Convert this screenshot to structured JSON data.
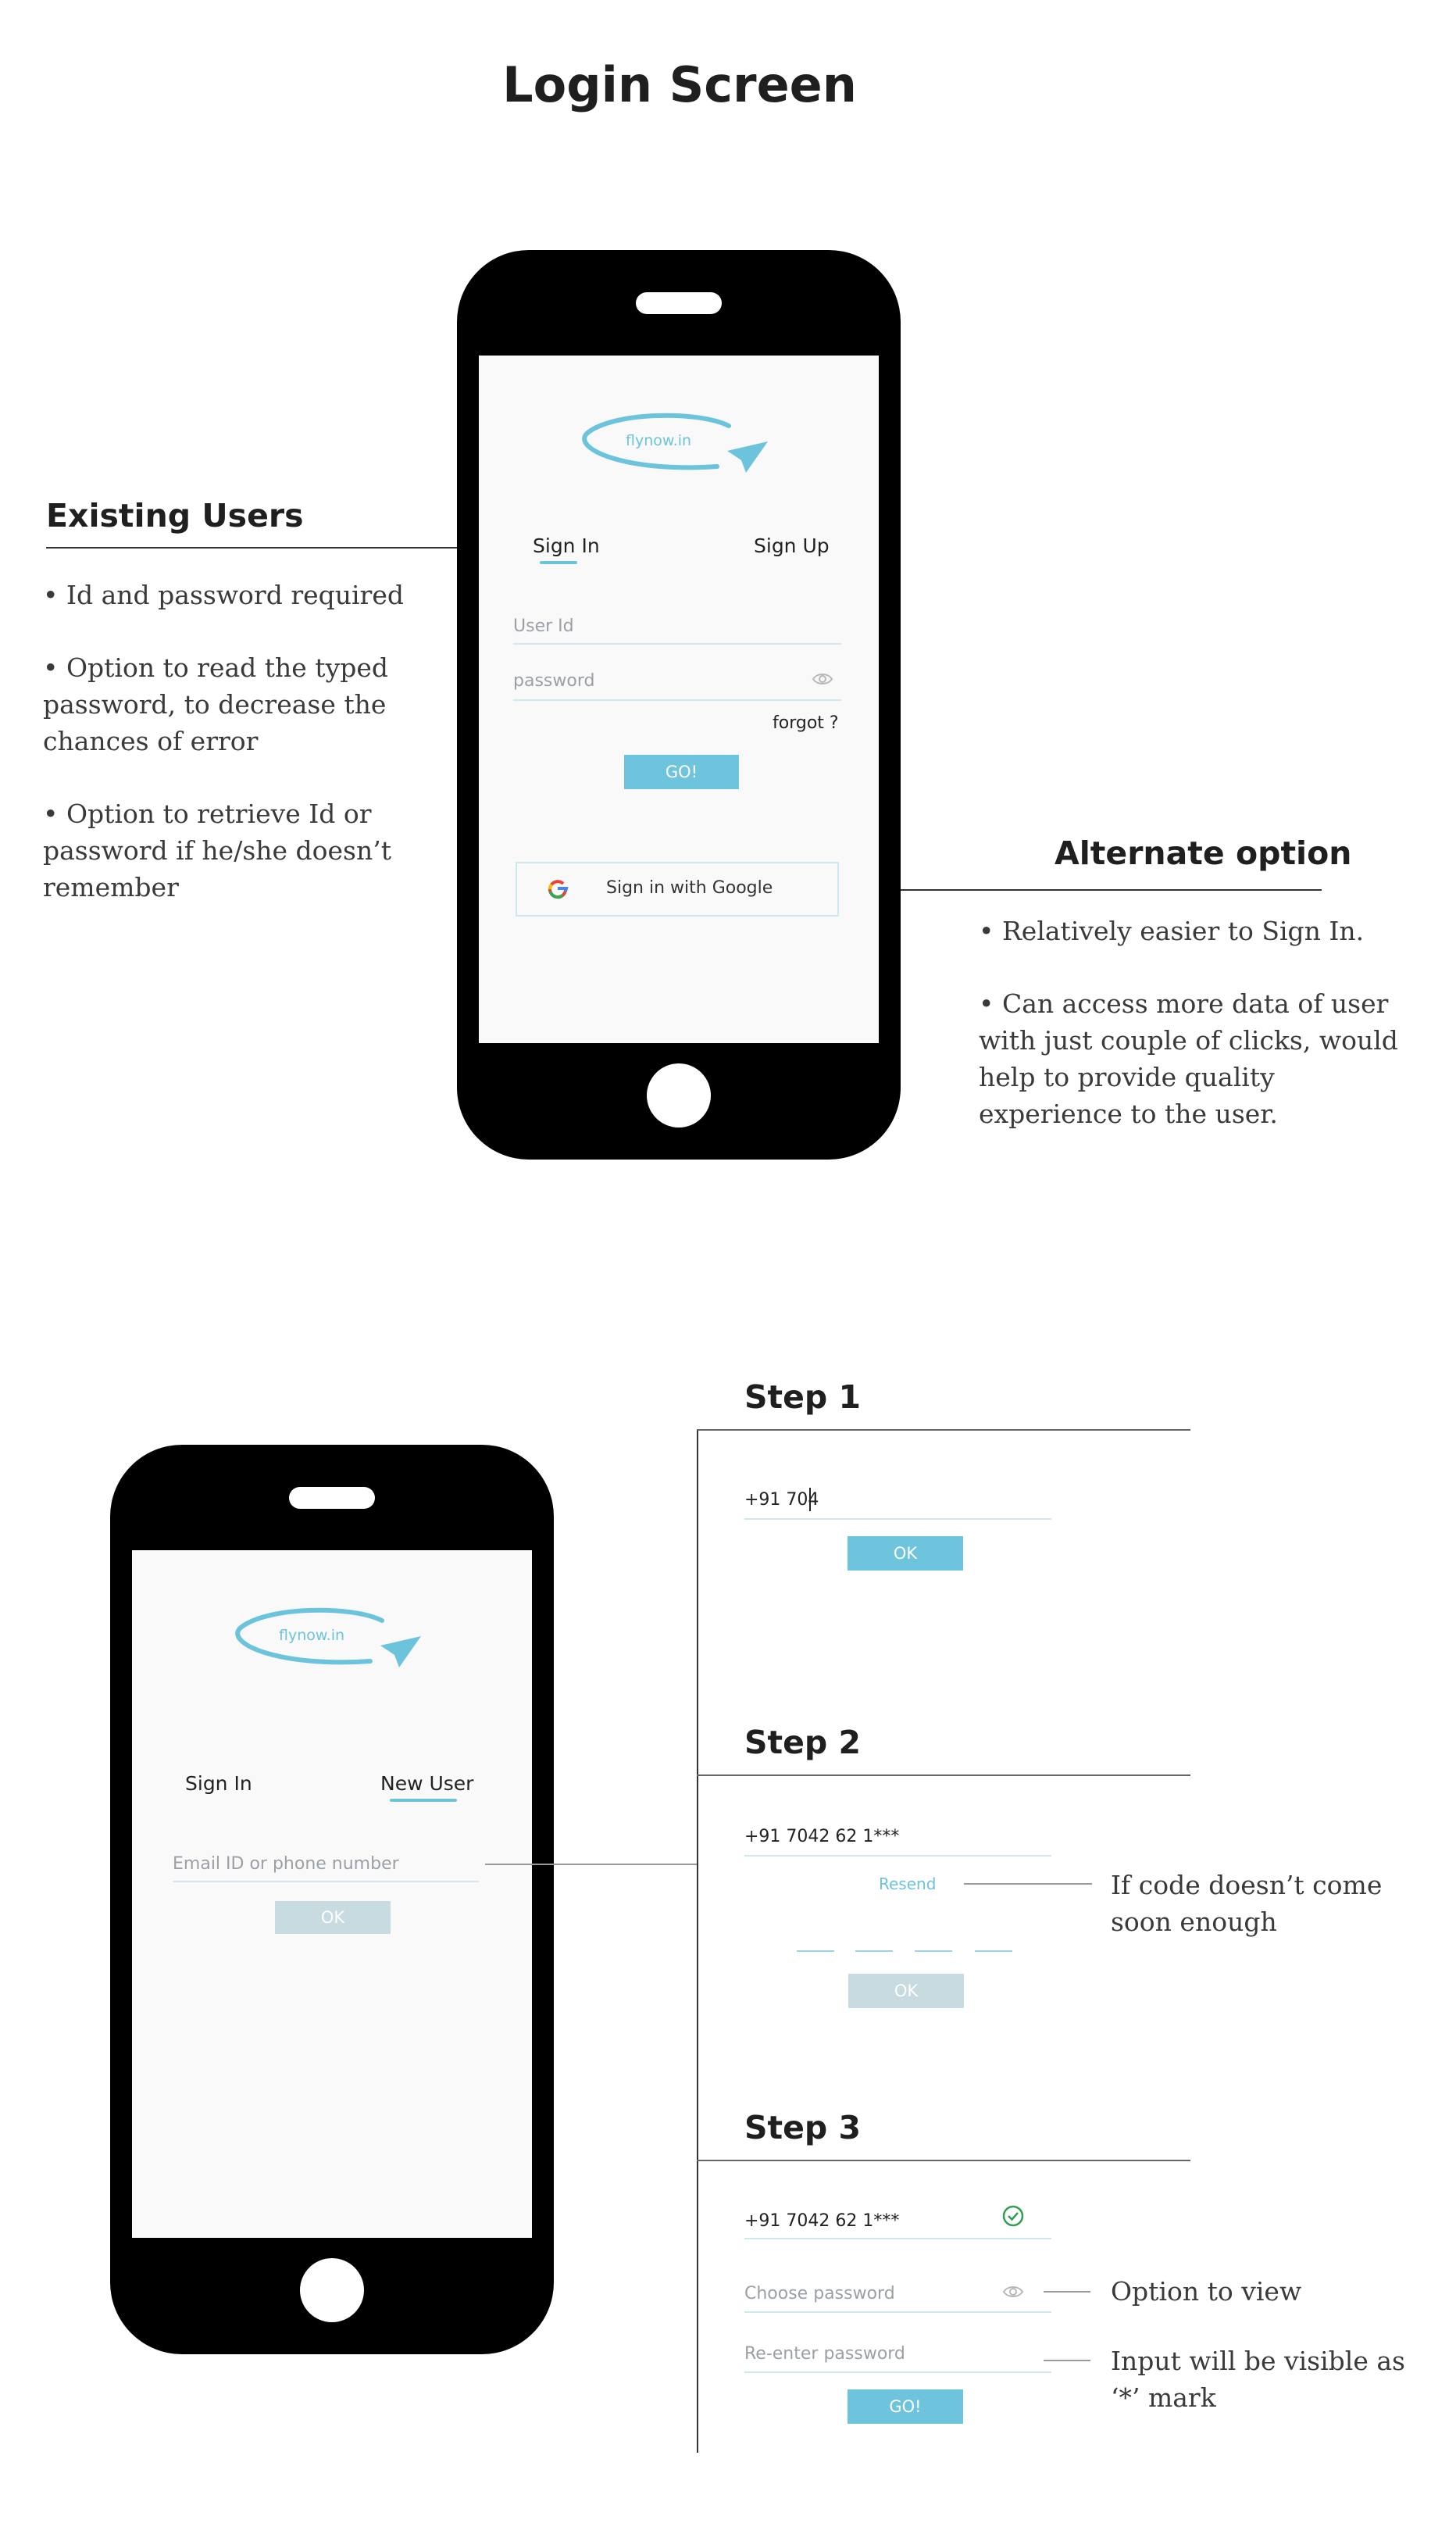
{
  "title": "Login Screen",
  "existing_users": {
    "heading": "Existing Users",
    "bullets": [
      "• Id and password required",
      "• Option to read the typed password, to decrease the chances of error",
      "• Option to retrieve Id or password if he/she doesn’t remember"
    ]
  },
  "alternate": {
    "heading": "Alternate option",
    "bullets": [
      "• Relatively easier to Sign In.",
      "• Can access more data of user with just couple of clicks, would help to provide quality experience to the user."
    ]
  },
  "phone1": {
    "logo_text": "flynow.in",
    "tab_signin": "Sign In",
    "tab_signup": "Sign Up",
    "userid_placeholder": "User Id",
    "password_placeholder": "password",
    "forgot": "forgot ?",
    "go": "GO!",
    "google": "Sign in with Google"
  },
  "phone2": {
    "logo_text": "flynow.in",
    "tab_signin": "Sign In",
    "tab_newuser": "New User",
    "email_placeholder": "Email ID or phone number",
    "ok": "OK"
  },
  "step1": {
    "heading": "Step 1",
    "phone_value": "+91 704",
    "ok": "OK"
  },
  "step2": {
    "heading": "Step 2",
    "phone_value": "+91 7042 62 1***",
    "resend": "Resend",
    "ok": "OK",
    "note": "If code doesn’t come soon enough"
  },
  "step3": {
    "heading": "Step 3",
    "phone_value": "+91 7042 62 1***",
    "choose_password": "Choose password",
    "reenter_password": "Re-enter password",
    "go": "GO!",
    "note_view": "Option to view",
    "note_visible": "Input will be visible as ‘*’ mark"
  },
  "colors": {
    "accent": "#6ec3dd",
    "disabled": "#c7dbe0",
    "check": "#2e9e4f"
  }
}
